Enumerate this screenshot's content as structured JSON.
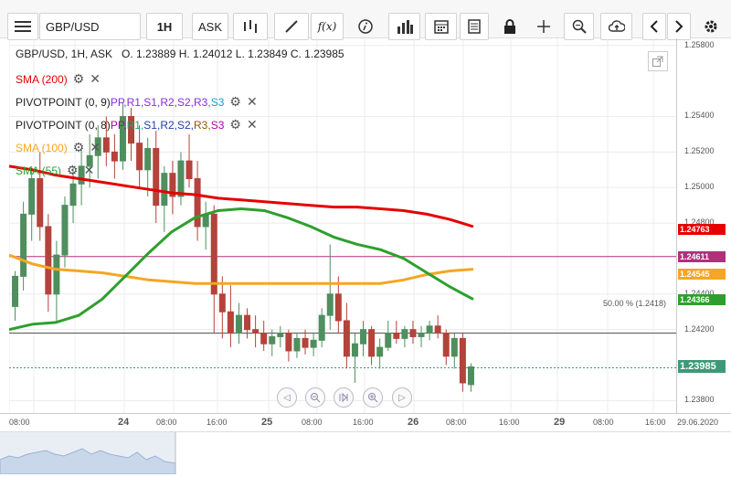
{
  "toolbar": {
    "symbol": "GBP/USD",
    "timeframe": "1H",
    "price_type": "ASK",
    "icons": [
      "menu-icon",
      "bar-type-icon",
      "draw-icon",
      "function-icon",
      "info-icon",
      "volume-icon",
      "calendar-icon",
      "report-icon",
      "lock-icon",
      "crosshair-icon",
      "zoom-icon",
      "cloud-upload-icon",
      "chevron-left-icon",
      "chevron-right-icon",
      "gear-icon"
    ],
    "function_label": "f(x)"
  },
  "header": {
    "quote": "GBP/USD, 1H, ASK   O. 1.23889 H. 1.24012 L. 1.23849 C. 1.23985"
  },
  "legends": [
    {
      "name": "sma-200",
      "prefix": "SMA (200)",
      "color": "#e60000",
      "parts": []
    },
    {
      "name": "pivot-1",
      "prefix": "PIVOTPOINT (0, 9)",
      "color": "#222222",
      "parts": [
        {
          "t": "PP",
          "c": "#8a2be2"
        },
        {
          "t": "R1",
          "c": "#8a2be2"
        },
        {
          "t": "S1",
          "c": "#8a2be2"
        },
        {
          "t": "R2",
          "c": "#8a2be2"
        },
        {
          "t": "S2",
          "c": "#8a2be2"
        },
        {
          "t": "R3",
          "c": "#8a2be2"
        },
        {
          "t": "S3",
          "c": "#1a9bd6"
        }
      ]
    },
    {
      "name": "pivot-2",
      "prefix": "PIVOTPOINT (0, 8)",
      "color": "#222222",
      "parts": [
        {
          "t": "PP",
          "c": "#b000b0"
        },
        {
          "t": "R1",
          "c": "#2e9f6e"
        },
        {
          "t": "S1",
          "c": "#1f3fb0"
        },
        {
          "t": "R2",
          "c": "#1f3fb0"
        },
        {
          "t": "S2",
          "c": "#1f3fb0"
        },
        {
          "t": "R3",
          "c": "#8a5a00"
        },
        {
          "t": "S3",
          "c": "#b000b0"
        }
      ]
    },
    {
      "name": "sma-100",
      "prefix": "SMA (100)",
      "color": "#f5a623",
      "parts": []
    },
    {
      "name": "sma-55",
      "prefix": "SMA (55)",
      "color": "#2e9f2e",
      "parts": []
    }
  ],
  "fib_label": "50.00 % (1.2418)",
  "price_axis": {
    "ticks": [
      "1.25800",
      "1.25400",
      "1.25200",
      "1.25000",
      "1.24800",
      "1.24400",
      "1.24200",
      "1.23800"
    ],
    "badges": [
      {
        "label": "1.24763",
        "color": "#e60000"
      },
      {
        "label": "1.24611",
        "color": "#b0307a"
      },
      {
        "label": "1.24545",
        "color": "#f5a623"
      },
      {
        "label": "1.24366",
        "color": "#2e9f2e"
      },
      {
        "label": "1.23985",
        "color": "#3c9a78"
      }
    ]
  },
  "time_axis": {
    "labels": [
      "08:00",
      "24",
      "08:00",
      "16:00",
      "25",
      "08:00",
      "16:00",
      "26",
      "08:00",
      "16:00",
      "29",
      "08:00",
      "16:00",
      "29.06.2020"
    ]
  },
  "colors": {
    "up": "#4f8f5e",
    "down": "#b4433b",
    "sma200": "#e60000",
    "sma100": "#f5a623",
    "sma55": "#2e9f2e"
  },
  "chart_data": {
    "type": "candlestick",
    "title": "GBP/USD, 1H, ASK",
    "ylim": [
      1.2373,
      1.2584
    ],
    "candles": [
      [
        1.2433,
        1.2453,
        1.2425,
        1.245
      ],
      [
        1.245,
        1.2492,
        1.2442,
        1.2485
      ],
      [
        1.2485,
        1.2512,
        1.247,
        1.2505
      ],
      [
        1.2505,
        1.252,
        1.247,
        1.2478
      ],
      [
        1.2478,
        1.2485,
        1.243,
        1.244
      ],
      [
        1.244,
        1.247,
        1.2425,
        1.2462
      ],
      [
        1.2462,
        1.2495,
        1.2455,
        1.249
      ],
      [
        1.249,
        1.2512,
        1.248,
        1.2502
      ],
      [
        1.2502,
        1.2522,
        1.249,
        1.2512
      ],
      [
        1.2512,
        1.253,
        1.25,
        1.2518
      ],
      [
        1.2518,
        1.2535,
        1.2505,
        1.2528
      ],
      [
        1.2528,
        1.254,
        1.2512,
        1.252
      ],
      [
        1.252,
        1.253,
        1.2505,
        1.2515
      ],
      [
        1.2515,
        1.2548,
        1.251,
        1.254
      ],
      [
        1.254,
        1.2545,
        1.2515,
        1.2525
      ],
      [
        1.2525,
        1.2535,
        1.25,
        1.251
      ],
      [
        1.251,
        1.2528,
        1.2495,
        1.2522
      ],
      [
        1.2522,
        1.2532,
        1.248,
        1.249
      ],
      [
        1.249,
        1.2512,
        1.2475,
        1.2508
      ],
      [
        1.2508,
        1.2515,
        1.2485,
        1.2495
      ],
      [
        1.2495,
        1.252,
        1.249,
        1.2515
      ],
      [
        1.2515,
        1.253,
        1.25,
        1.2505
      ],
      [
        1.2505,
        1.2515,
        1.247,
        1.2478
      ],
      [
        1.2478,
        1.2492,
        1.2465,
        1.2485
      ],
      [
        1.2485,
        1.249,
        1.2418,
        1.244
      ],
      [
        1.244,
        1.245,
        1.2415,
        1.243
      ],
      [
        1.243,
        1.2445,
        1.241,
        1.2418
      ],
      [
        1.2418,
        1.2435,
        1.2412,
        1.2428
      ],
      [
        1.2428,
        1.2432,
        1.2415,
        1.242
      ],
      [
        1.242,
        1.2428,
        1.241,
        1.2418
      ],
      [
        1.2418,
        1.2425,
        1.2408,
        1.2412
      ],
      [
        1.2412,
        1.242,
        1.2405,
        1.2416
      ],
      [
        1.2416,
        1.2422,
        1.241,
        1.2418
      ],
      [
        1.2418,
        1.242,
        1.2402,
        1.2408
      ],
      [
        1.2408,
        1.2418,
        1.2404,
        1.2415
      ],
      [
        1.2415,
        1.242,
        1.2406,
        1.241
      ],
      [
        1.241,
        1.2418,
        1.2405,
        1.2414
      ],
      [
        1.2414,
        1.2432,
        1.241,
        1.2428
      ],
      [
        1.2428,
        1.2468,
        1.242,
        1.244
      ],
      [
        1.244,
        1.245,
        1.2418,
        1.2425
      ],
      [
        1.2425,
        1.2435,
        1.2398,
        1.2405
      ],
      [
        1.2405,
        1.2418,
        1.239,
        1.2412
      ],
      [
        1.2412,
        1.2425,
        1.2405,
        1.242
      ],
      [
        1.242,
        1.2422,
        1.24,
        1.2405
      ],
      [
        1.2405,
        1.2415,
        1.2398,
        1.241
      ],
      [
        1.241,
        1.2425,
        1.2408,
        1.2418
      ],
      [
        1.2418,
        1.2425,
        1.2412,
        1.2415
      ],
      [
        1.2415,
        1.2422,
        1.241,
        1.242
      ],
      [
        1.242,
        1.2425,
        1.2412,
        1.2416
      ],
      [
        1.2416,
        1.2422,
        1.241,
        1.2418
      ],
      [
        1.2418,
        1.2425,
        1.2414,
        1.2422
      ],
      [
        1.2422,
        1.2428,
        1.2415,
        1.2418
      ],
      [
        1.2418,
        1.242,
        1.24,
        1.2405
      ],
      [
        1.2405,
        1.2418,
        1.2398,
        1.2415
      ],
      [
        1.2415,
        1.2418,
        1.2385,
        1.239
      ],
      [
        1.2389,
        1.2401,
        1.2385,
        1.2399
      ]
    ],
    "sma200": [
      1.2512,
      1.251,
      1.2507,
      1.2505,
      1.2503,
      1.2501,
      1.2499,
      1.2497,
      1.2496,
      1.2494,
      1.2493,
      1.2492,
      1.2491,
      1.249,
      1.2489,
      1.2489,
      1.2488,
      1.2487,
      1.2485,
      1.2482,
      1.2478
    ],
    "sma100": [
      1.2462,
      1.2457,
      1.2454,
      1.2453,
      1.2452,
      1.245,
      1.2448,
      1.2447,
      1.2446,
      1.2446,
      1.2446,
      1.2446,
      1.2446,
      1.2446,
      1.2446,
      1.2446,
      1.2446,
      1.2448,
      1.2451,
      1.2453,
      1.2454
    ],
    "sma55": [
      1.242,
      1.2423,
      1.2424,
      1.2428,
      1.2437,
      1.245,
      1.2463,
      1.2475,
      1.2483,
      1.2487,
      1.2488,
      1.2487,
      1.2483,
      1.2478,
      1.2472,
      1.2468,
      1.2465,
      1.246,
      1.2452,
      1.2444,
      1.2437
    ],
    "hlines": [
      1.24611,
      1.2418,
      1.23985
    ]
  }
}
